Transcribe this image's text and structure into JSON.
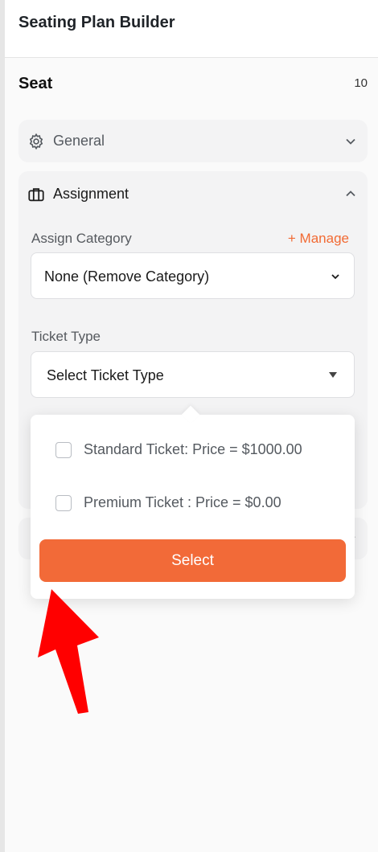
{
  "app": {
    "title": "Seating Plan Builder"
  },
  "seat": {
    "title": "Seat",
    "count": "10"
  },
  "panels": {
    "general": {
      "label": "General",
      "icon": "gear-icon"
    },
    "assignment": {
      "label": "Assignment",
      "icon": "briefcase-icon",
      "assign_category_label": "Assign Category",
      "manage_label": "+ Manage",
      "category_value": "None (Remove Category)",
      "ticket_type_label": "Ticket Type",
      "ticket_placeholder": "Select Ticket Type"
    }
  },
  "ticket_dropdown": {
    "options": [
      {
        "label": "Standard Ticket: Price = $1000.00",
        "checked": false
      },
      {
        "label": "Premium Ticket : Price = $0.00",
        "checked": false
      }
    ],
    "select_label": "Select"
  },
  "colors": {
    "accent": "#f26a38",
    "annotation_arrow": "#ff0000"
  }
}
